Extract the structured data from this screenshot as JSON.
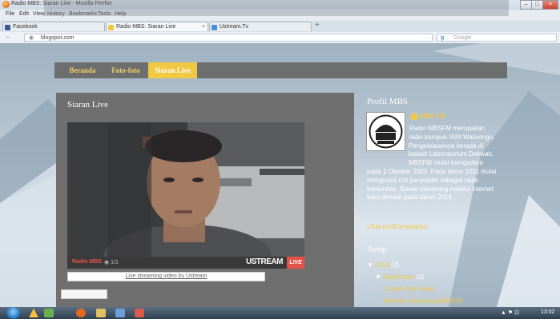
{
  "window": {
    "title": "Radio MBS: Siaran Live - Mozilla Firefox",
    "controls": [
      "–",
      "□",
      "×"
    ]
  },
  "menu": [
    "File",
    "Edit",
    "View",
    "History",
    "Bookmarks",
    "Tools",
    "Help"
  ],
  "tabs": [
    {
      "label": "Facebook",
      "favicon_color": "#3b5998"
    },
    {
      "label": "Radio MBS: Siaran Live",
      "favicon_color": "#f1c842"
    },
    {
      "label": "Ustream.Tv",
      "favicon_color": "#4a90d9"
    }
  ],
  "new_tab": "+",
  "url": "blogspot.com",
  "search_placeholder": "Google",
  "blog": {
    "nav": [
      {
        "label": "Beranda"
      },
      {
        "label": "Foto-foto"
      },
      {
        "label": "Siaran Live",
        "active": true
      }
    ],
    "post_title": "Siaran Live",
    "player": {
      "channel": "Radio MBS",
      "viewers": "1/1",
      "brand": "USTREAM",
      "live": "LIVE",
      "link": "Live streaming video by Ustream"
    }
  },
  "sidebar": {
    "profile_title": "Profil MBS",
    "profile_name": "MBS FM",
    "profile_desc": "Radio MBSFM merupakan radio kampus IAIN Walisongo. Pengelolaannya berada di bawah Laboratorium Dakwah. MBSFM mulai mengudara pada 1 Oktober 2000. Pada tahun 2011 mulai mengurusi izin penyiaran sebagai radio komunitas. Siaran streaming melalui internet baru dimulai pada tahun 2014.",
    "profile_link": "Lihat profil lengkapku",
    "archive_title": "Arsip",
    "archive": {
      "year": "2014",
      "year_count": "(2)",
      "month": "September",
      "month_count": "(2)",
      "posts": [
        "Contoh Pos Video",
        "Website Streaming MBSFM"
      ]
    }
  },
  "taskbar": {
    "tray": "▲ ⚑ ⊡",
    "clock": "13:02"
  },
  "colors": {
    "accent_yellow": "#f1c842",
    "live_red": "#e3524a",
    "panel_gray": "#6f6f6f"
  }
}
